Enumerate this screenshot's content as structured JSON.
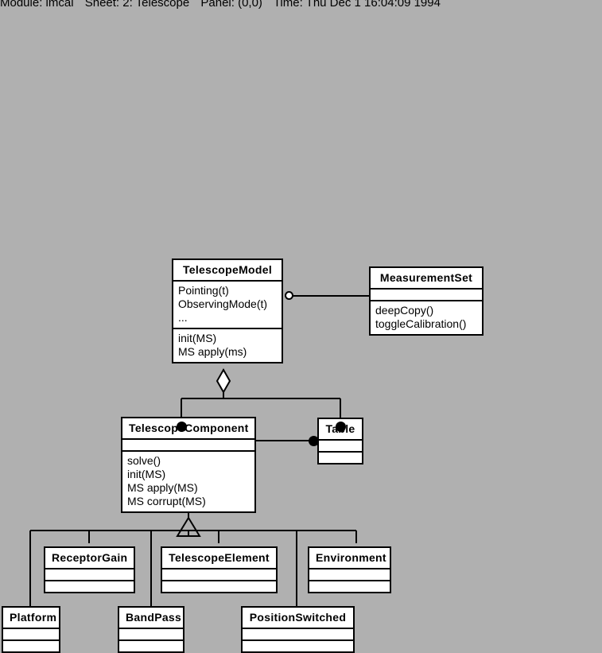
{
  "titlebar": {
    "module_label": "Module: lmcal",
    "sheet_label": "Sheet: 2: Telescope",
    "panel_label": "Panel: (0,0)",
    "time_label": "Time: Thu Dec  1 16:04:09 1994"
  },
  "diagram": {
    "kind": "uml-class-diagram",
    "background_color": "#b0b0b0",
    "box_fill_color": "#ffffff",
    "line_color": "#000000",
    "classes": [
      {
        "id": "telescope-model",
        "name": "TelescopeModel",
        "attributes": "Pointing(t)\nObservingMode(t)\n...",
        "operations": "init(MS)\nMS apply(ms)"
      },
      {
        "id": "measurement-set",
        "name": "MeasurementSet",
        "attributes": "",
        "operations": "deepCopy()\ntoggleCalibration()"
      },
      {
        "id": "telescope-component",
        "name": "TelescopeComponent",
        "attributes": "",
        "operations": "solve()\ninit(MS)\nMS apply(MS)\nMS corrupt(MS)"
      },
      {
        "id": "table",
        "name": "Table",
        "attributes": "",
        "operations": ""
      },
      {
        "id": "receptor-gain",
        "name": "ReceptorGain",
        "attributes": "",
        "operations": ""
      },
      {
        "id": "telescope-element",
        "name": "TelescopeElement",
        "attributes": "",
        "operations": ""
      },
      {
        "id": "environment",
        "name": "Environment",
        "attributes": "",
        "operations": ""
      },
      {
        "id": "platform",
        "name": "Platform",
        "attributes": "",
        "operations": ""
      },
      {
        "id": "band-pass",
        "name": "BandPass",
        "attributes": "",
        "operations": ""
      },
      {
        "id": "position-switched",
        "name": "PositionSwitched",
        "attributes": "",
        "operations": ""
      }
    ],
    "relations": [
      {
        "id": "model-measurementset",
        "type": "association",
        "from": "telescope-model",
        "to": "measurement-set",
        "from_adornment": "hollow-circle"
      },
      {
        "id": "model-aggregation",
        "type": "aggregation",
        "from": "telescope-model",
        "to": [
          "telescope-component",
          "table"
        ],
        "from_adornment": "hollow-diamond",
        "to_adornment": "filled-circle"
      },
      {
        "id": "component-table",
        "type": "association",
        "from": "telescope-component",
        "to": "table",
        "to_adornment": "filled-circle"
      },
      {
        "id": "component-generalization",
        "type": "generalization",
        "from": "telescope-component",
        "to": [
          "receptor-gain",
          "telescope-element",
          "environment",
          "platform",
          "band-pass",
          "position-switched"
        ],
        "from_adornment": "hollow-triangle"
      }
    ]
  }
}
